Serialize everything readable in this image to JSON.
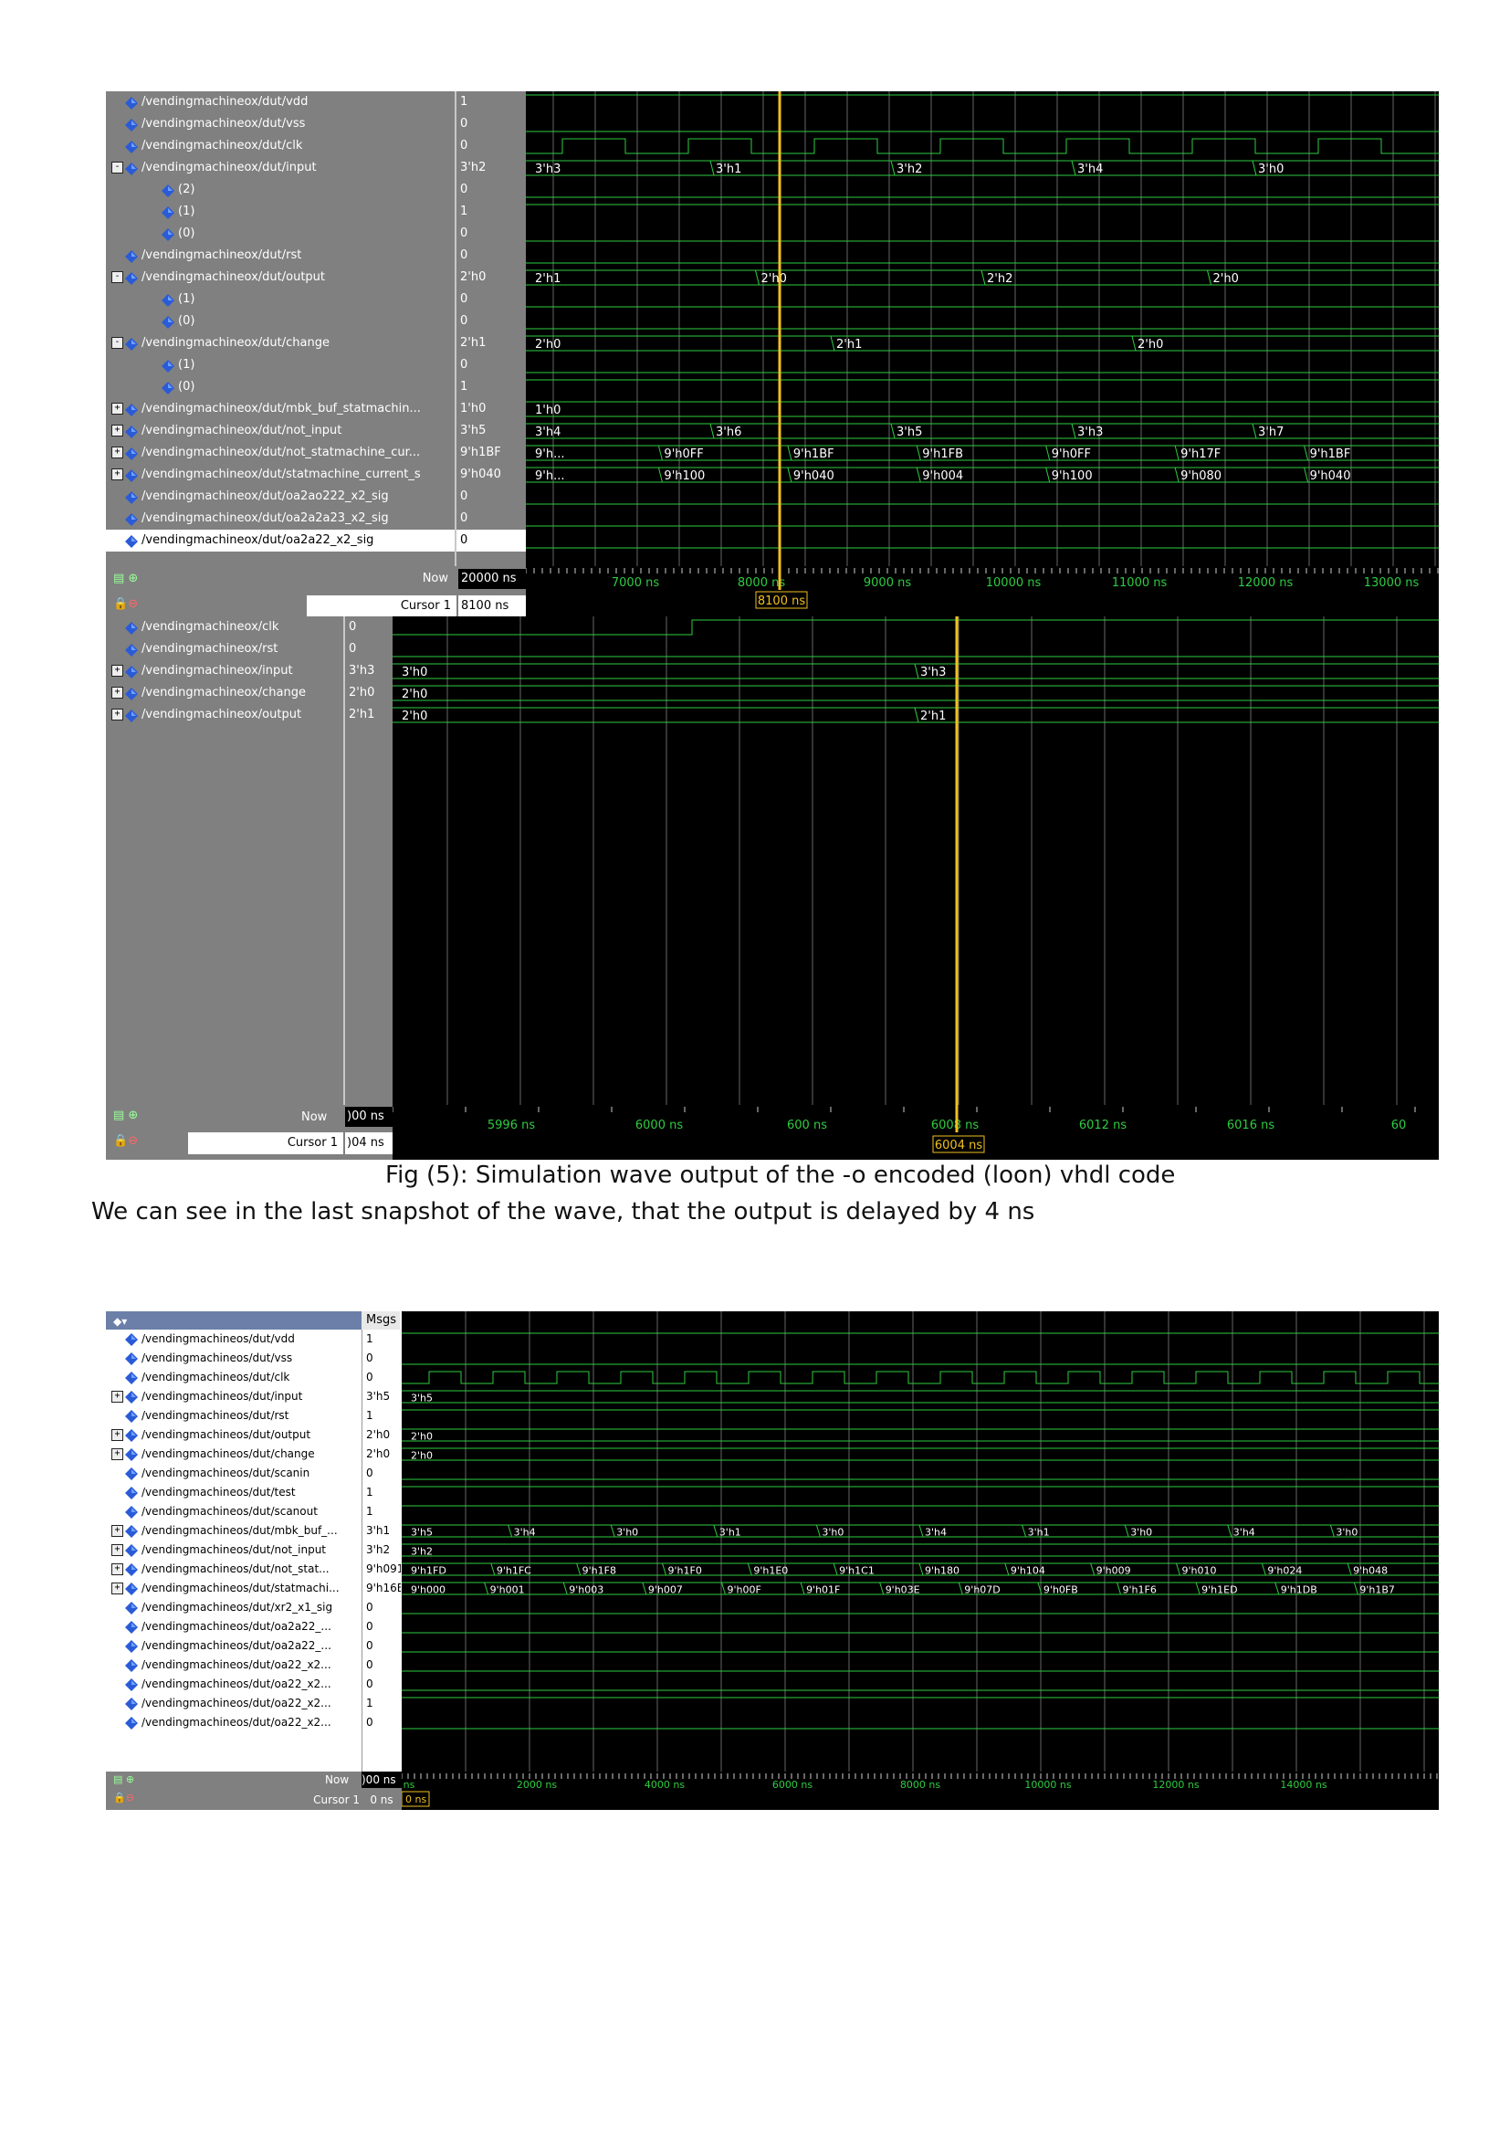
{
  "waveform1": {
    "signals": [
      {
        "name": "/vendingmachineox/dut/vdd",
        "value": "1",
        "expander": "",
        "indent": 0
      },
      {
        "name": "/vendingmachineox/dut/vss",
        "value": "0",
        "expander": "",
        "indent": 0
      },
      {
        "name": "/vendingmachineox/dut/clk",
        "value": "0",
        "expander": "",
        "indent": 0
      },
      {
        "name": "/vendingmachineox/dut/input",
        "value": "3'h2",
        "expander": "-",
        "indent": 0
      },
      {
        "name": "(2)",
        "value": "0",
        "expander": "",
        "indent": 1
      },
      {
        "name": "(1)",
        "value": "1",
        "expander": "",
        "indent": 1
      },
      {
        "name": "(0)",
        "value": "0",
        "expander": "",
        "indent": 1
      },
      {
        "name": "/vendingmachineox/dut/rst",
        "value": "0",
        "expander": "",
        "indent": 0
      },
      {
        "name": "/vendingmachineox/dut/output",
        "value": "2'h0",
        "expander": "-",
        "indent": 0
      },
      {
        "name": "(1)",
        "value": "0",
        "expander": "",
        "indent": 1
      },
      {
        "name": "(0)",
        "value": "0",
        "expander": "",
        "indent": 1
      },
      {
        "name": "/vendingmachineox/dut/change",
        "value": "2'h1",
        "expander": "-",
        "indent": 0
      },
      {
        "name": "(1)",
        "value": "0",
        "expander": "",
        "indent": 1
      },
      {
        "name": "(0)",
        "value": "1",
        "expander": "",
        "indent": 1
      },
      {
        "name": "/vendingmachineox/dut/mbk_buf_statmachin...",
        "value": "1'h0",
        "expander": "+",
        "indent": 0
      },
      {
        "name": "/vendingmachineox/dut/not_input",
        "value": "3'h5",
        "expander": "+",
        "indent": 0
      },
      {
        "name": "/vendingmachineox/dut/not_statmachine_cur...",
        "value": "9'h1BF",
        "expander": "+",
        "indent": 0
      },
      {
        "name": "/vendingmachineox/dut/statmachine_current_s",
        "value": "9'h040",
        "expander": "+",
        "indent": 0
      },
      {
        "name": "/vendingmachineox/dut/oa2ao222_x2_sig",
        "value": "0",
        "expander": "",
        "indent": 0
      },
      {
        "name": "/vendingmachineox/dut/oa2a2a23_x2_sig",
        "value": "0",
        "expander": "",
        "indent": 0
      },
      {
        "name": "/vendingmachineox/dut/oa2a22_x2_sig",
        "value": "0",
        "expander": "",
        "indent": 0
      }
    ],
    "bus_labels": [
      {
        "row": 3,
        "labels": [
          "3'h3",
          "3'h1",
          "3'h2",
          "3'h4",
          "3'h0"
        ]
      },
      {
        "row": 8,
        "labels": [
          "2'h1",
          "2'h0",
          "2'h2",
          "2'h0"
        ]
      },
      {
        "row": 11,
        "labels": [
          "2'h0",
          "2'h1",
          "2'h0"
        ]
      },
      {
        "row": 14,
        "labels": [
          "1'h0"
        ]
      },
      {
        "row": 15,
        "labels": [
          "3'h4",
          "3'h6",
          "3'h5",
          "3'h3",
          "3'h7"
        ]
      },
      {
        "row": 16,
        "labels": [
          "9'h...",
          "9'h0FF",
          "9'h1BF",
          "9'h1FB",
          "9'h0FF",
          "9'h17F",
          "9'h1BF"
        ]
      },
      {
        "row": 17,
        "labels": [
          "9'h...",
          "9'h100",
          "9'h040",
          "9'h004",
          "9'h100",
          "9'h080",
          "9'h040"
        ]
      }
    ],
    "footer": {
      "now_label": "Now",
      "now_value": "20000 ns",
      "cursor_label": "Cursor 1",
      "cursor_value": "8100 ns",
      "cursor_tag": "8100 ns"
    },
    "ticks": [
      "7000 ns",
      "8000 ns",
      "9000 ns",
      "10000 ns",
      "11000 ns",
      "12000 ns",
      "13000 ns"
    ]
  },
  "waveform2": {
    "signals": [
      {
        "name": "/vendingmachineox/clk",
        "value": "0",
        "expander": ""
      },
      {
        "name": "/vendingmachineox/rst",
        "value": "0",
        "expander": ""
      },
      {
        "name": "/vendingmachineox/input",
        "value": "3'h3",
        "expander": "+"
      },
      {
        "name": "/vendingmachineox/change",
        "value": "2'h0",
        "expander": "+"
      },
      {
        "name": "/vendingmachineox/output",
        "value": "2'h1",
        "expander": "+"
      }
    ],
    "bus_labels": [
      {
        "row": 2,
        "labels": [
          "3'h0",
          "3'h3"
        ]
      },
      {
        "row": 3,
        "labels": [
          "2'h0"
        ]
      },
      {
        "row": 4,
        "labels": [
          "2'h0",
          "2'h1"
        ]
      }
    ],
    "footer": {
      "now_label": "Now",
      "now_value": ")00 ns",
      "cursor_label": "Cursor 1",
      "cursor_value": ")04 ns",
      "cursor_tag": "6004 ns"
    },
    "ticks": [
      "5996 ns",
      "6000 ns",
      "600 ns",
      "6008 ns",
      "6012 ns",
      "6016 ns",
      "60"
    ]
  },
  "caption": "Fig (5): Simulation wave output of the -o encoded (loon) vhdl code",
  "body_text": "We can see in the last snapshot of the wave, that the output is delayed by 4 ns",
  "waveform3": {
    "header_msgs": "Msgs",
    "signals": [
      {
        "name": "/vendingmachineos/dut/vdd",
        "value": "1",
        "expander": ""
      },
      {
        "name": "/vendingmachineos/dut/vss",
        "value": "0",
        "expander": ""
      },
      {
        "name": "/vendingmachineos/dut/clk",
        "value": "0",
        "expander": ""
      },
      {
        "name": "/vendingmachineos/dut/input",
        "value": "3'h5",
        "expander": "+"
      },
      {
        "name": "/vendingmachineos/dut/rst",
        "value": "1",
        "expander": ""
      },
      {
        "name": "/vendingmachineos/dut/output",
        "value": "2'h0",
        "expander": "+"
      },
      {
        "name": "/vendingmachineos/dut/change",
        "value": "2'h0",
        "expander": "+"
      },
      {
        "name": "/vendingmachineos/dut/scanin",
        "value": "0",
        "expander": ""
      },
      {
        "name": "/vendingmachineos/dut/test",
        "value": "1",
        "expander": ""
      },
      {
        "name": "/vendingmachineos/dut/scanout",
        "value": "1",
        "expander": ""
      },
      {
        "name": "/vendingmachineos/dut/mbk_buf_...",
        "value": "3'h1",
        "expander": "+"
      },
      {
        "name": "/vendingmachineos/dut/not_input",
        "value": "3'h2",
        "expander": "+"
      },
      {
        "name": "/vendingmachineos/dut/not_stat...",
        "value": "9'h091",
        "expander": "+"
      },
      {
        "name": "/vendingmachineos/dut/statmachi...",
        "value": "9'h16E",
        "expander": "+"
      },
      {
        "name": "/vendingmachineos/dut/xr2_x1_sig",
        "value": "0",
        "expander": ""
      },
      {
        "name": "/vendingmachineos/dut/oa2a22_...",
        "value": "0",
        "expander": ""
      },
      {
        "name": "/vendingmachineos/dut/oa2a22_...",
        "value": "0",
        "expander": ""
      },
      {
        "name": "/vendingmachineos/dut/oa22_x2...",
        "value": "0",
        "expander": ""
      },
      {
        "name": "/vendingmachineos/dut/oa22_x2...",
        "value": "0",
        "expander": ""
      },
      {
        "name": "/vendingmachineos/dut/oa22_x2...",
        "value": "1",
        "expander": ""
      },
      {
        "name": "/vendingmachineos/dut/oa22_x2...",
        "value": "0",
        "expander": ""
      }
    ],
    "bus_labels": [
      {
        "row": 3,
        "labels": [
          "3'h5"
        ]
      },
      {
        "row": 5,
        "labels": [
          "2'h0"
        ]
      },
      {
        "row": 6,
        "labels": [
          "2'h0"
        ]
      },
      {
        "row": 10,
        "labels": [
          "3'h5",
          "3'h4",
          "3'h0",
          "3'h1",
          "3'h0",
          "3'h4",
          "3'h1",
          "3'h0",
          "3'h4",
          "3'h0"
        ]
      },
      {
        "row": 11,
        "labels": [
          "3'h2"
        ]
      },
      {
        "row": 12,
        "labels": [
          "9'h1FD",
          "9'h1FC",
          "9'h1F8",
          "9'h1F0",
          "9'h1E0",
          "9'h1C1",
          "9'h180",
          "9'h104",
          "9'h009",
          "9'h010",
          "9'h024",
          "9'h048"
        ]
      },
      {
        "row": 13,
        "labels": [
          "9'h000",
          "9'h001",
          "9'h003",
          "9'h007",
          "9'h00F",
          "9'h01F",
          "9'h03E",
          "9'h07D",
          "9'h0FB",
          "9'h1F6",
          "9'h1ED",
          "9'h1DB",
          "9'h1B7"
        ]
      }
    ],
    "footer": {
      "now_label": "Now",
      "now_value": ")00 ns",
      "cursor_label": "Cursor 1",
      "cursor_value": "0 ns",
      "cursor_tag": "0 ns"
    },
    "ticks": [
      "ns",
      "2000 ns",
      "4000 ns",
      "6000 ns",
      "8000 ns",
      "10000 ns",
      "12000 ns",
      "14000 ns"
    ]
  },
  "colors": {
    "wave": "#2ecc40",
    "cursor": "#f0c020",
    "panel_gray": "#808080",
    "bg": "#000000"
  }
}
